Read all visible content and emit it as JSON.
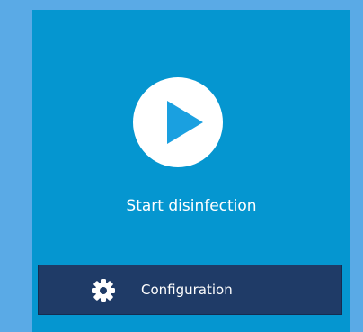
{
  "start": {
    "label": "Start disinfection",
    "icon": "play-icon"
  },
  "config": {
    "label": "Configuration",
    "icon": "gear-icon"
  },
  "colors": {
    "outer_background": "#5aaae6",
    "panel_background": "#0596d0",
    "play_circle": "#ffffff",
    "play_triangle": "#1aa0e0",
    "config_bar": "#1f3b67",
    "text": "#ffffff"
  }
}
